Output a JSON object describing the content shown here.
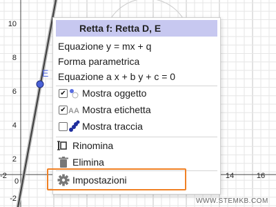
{
  "graph": {
    "y_ticks": [
      "10",
      "8",
      "6",
      "4",
      "2",
      "-2"
    ],
    "x_ticks": [
      "-2",
      "0",
      "14",
      "16"
    ],
    "point_label": "E",
    "line_color": "#3d3d3d",
    "point_color": "#4a62d8"
  },
  "menu": {
    "title": "Retta f: Retta D, E",
    "items": {
      "equation_ymx": "Equazione y = mx + q",
      "parametric": "Forma parametrica",
      "equation_abc": "Equazione a x + b y + c = 0",
      "show_object": "Mostra oggetto",
      "show_label": "Mostra etichetta",
      "show_trace": "Mostra traccia",
      "rename": "Rinomina",
      "delete": "Elimina",
      "settings": "Impostazioni"
    },
    "checkbox_states": {
      "show_object": true,
      "show_label": true,
      "show_trace": false
    },
    "highlight_color": "#f08024"
  },
  "watermark": "WWW.STEMKB.COM"
}
